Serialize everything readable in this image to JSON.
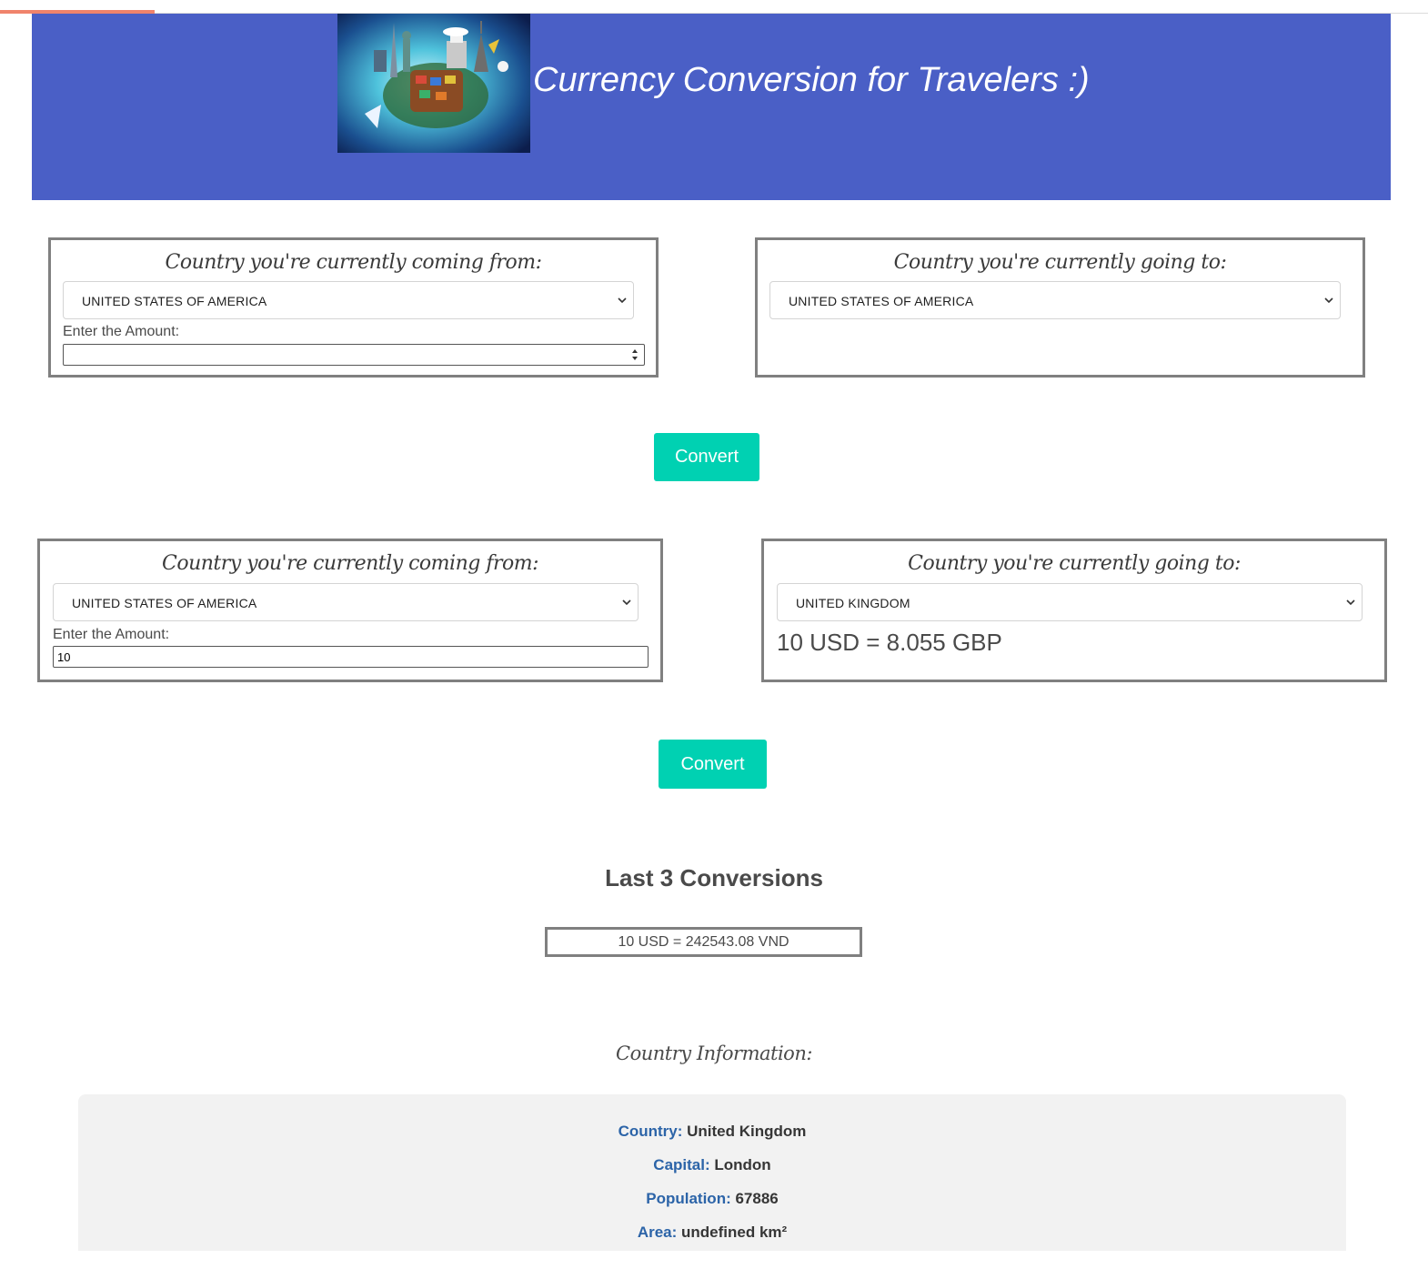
{
  "header": {
    "title": "Currency Conversion for Travelers :)",
    "banner_color": "#4a5fc6",
    "image": "travel-globe-image"
  },
  "form1": {
    "from_heading": "Country you're currently coming from:",
    "from_country": "UNITED STATES OF AMERICA",
    "amount_label": "Enter the Amount:",
    "amount_value": "",
    "to_heading": "Country you're currently going to:",
    "to_country": "UNITED STATES OF AMERICA",
    "convert_label": "Convert"
  },
  "form2": {
    "from_heading": "Country you're currently coming from:",
    "from_country": "UNITED STATES OF AMERICA",
    "amount_label": "Enter the Amount:",
    "amount_value": "10",
    "to_heading": "Country you're currently going to:",
    "to_country": "UNITED KINGDOM",
    "result": "10 USD = 8.055 GBP",
    "convert_label": "Convert"
  },
  "history": {
    "title": "Last 3 Conversions",
    "items": [
      "10 USD = 242543.08 VND"
    ]
  },
  "country_info": {
    "heading": "Country Information:",
    "country_key": "Country:",
    "country_val": "United Kingdom",
    "capital_key": "Capital:",
    "capital_val": "London",
    "population_key": "Population:",
    "population_val": "67886",
    "area_key": "Area:",
    "area_val": "undefined km²"
  },
  "colors": {
    "button": "#00d1b2",
    "info_key": "#2c64a8",
    "progress": "#f0836c"
  }
}
